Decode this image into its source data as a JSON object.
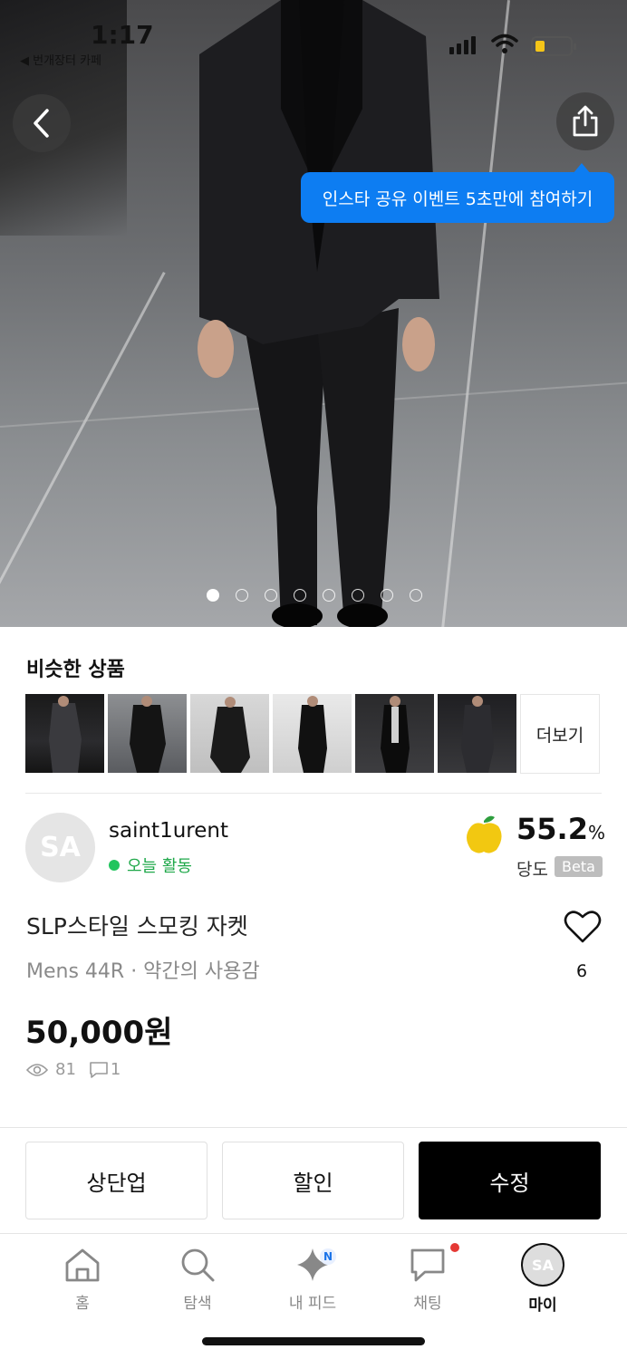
{
  "status": {
    "time": "1:17",
    "back_app": "◀ 번개장터 카페"
  },
  "hero": {
    "dots_total": 8,
    "active_dot": 0,
    "tooltip": "인스타 공유 이벤트 5초만에 참여하기"
  },
  "similar": {
    "title": "비슷한 상품",
    "more": "더보기"
  },
  "seller": {
    "avatar_initials": "SA",
    "name": "saint1urent",
    "activity": "오늘 활동",
    "score": "55.2",
    "score_unit": "%",
    "score_label": "당도",
    "score_badge": "Beta"
  },
  "product": {
    "title": "SLP스타일 스모킹 자켓",
    "subtitle": "Mens 44R · 약간의 사용감",
    "likes": "6",
    "price": "50,000원",
    "views": "81",
    "comments": "1"
  },
  "actions": {
    "bump": "상단업",
    "discount": "할인",
    "edit": "수정"
  },
  "nav": {
    "home": "홈",
    "search": "탐색",
    "feed": "내 피드",
    "feed_badge": "N",
    "chat": "채팅",
    "my": "마이",
    "my_initials": "SA"
  },
  "colors": {
    "accent_blue": "#0d7df2",
    "active_green": "#1fa84a",
    "badge_red": "#e53935"
  }
}
